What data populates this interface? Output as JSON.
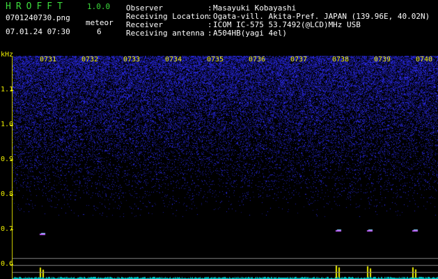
{
  "header": {
    "logo": "HROFFT",
    "version": "1.0.0",
    "filename": "0701240730.png",
    "datetime": "07.01.24 07:30",
    "meteor_label": "meteor",
    "meteor_count": "6"
  },
  "station": {
    "rows": [
      {
        "label": "Observer",
        "sep": ":",
        "value": "Masayuki Kobayashi"
      },
      {
        "label": "Receiving Location",
        "sep": ":",
        "value": "Ogata-vill. Akita-Pref. JAPAN (139.96E, 40.02N)"
      },
      {
        "label": "Receiver",
        "sep": ":",
        "value": "ICOM IC-575 53.7492(@LCD)MHz USB"
      },
      {
        "label": "Receiving antenna",
        "sep": ":",
        "value": "A504HB(yagi 4el)"
      }
    ]
  },
  "spectrogram": {
    "unit": "kHz",
    "y_ticks": [
      "1.1",
      "1.0",
      "0.9",
      "0.8",
      "0.7",
      "0.6"
    ],
    "time_labels": [
      "0731",
      "0732",
      "0733",
      "0734",
      "0735",
      "0736",
      "0737",
      "0738",
      "0739",
      "0740"
    ],
    "meteor_echoes": [
      {
        "time": "07:30:50",
        "freq_khz": 0.69
      },
      {
        "time": "07:37:55",
        "freq_khz": 0.7
      },
      {
        "time": "07:38:40",
        "freq_khz": 0.7
      },
      {
        "time": "07:39:45",
        "freq_khz": 0.7
      }
    ],
    "colors": {
      "noise": "#2020c8",
      "label": "#f0f000",
      "echo": "#f0f000",
      "baseline": "#00c8c8"
    }
  }
}
